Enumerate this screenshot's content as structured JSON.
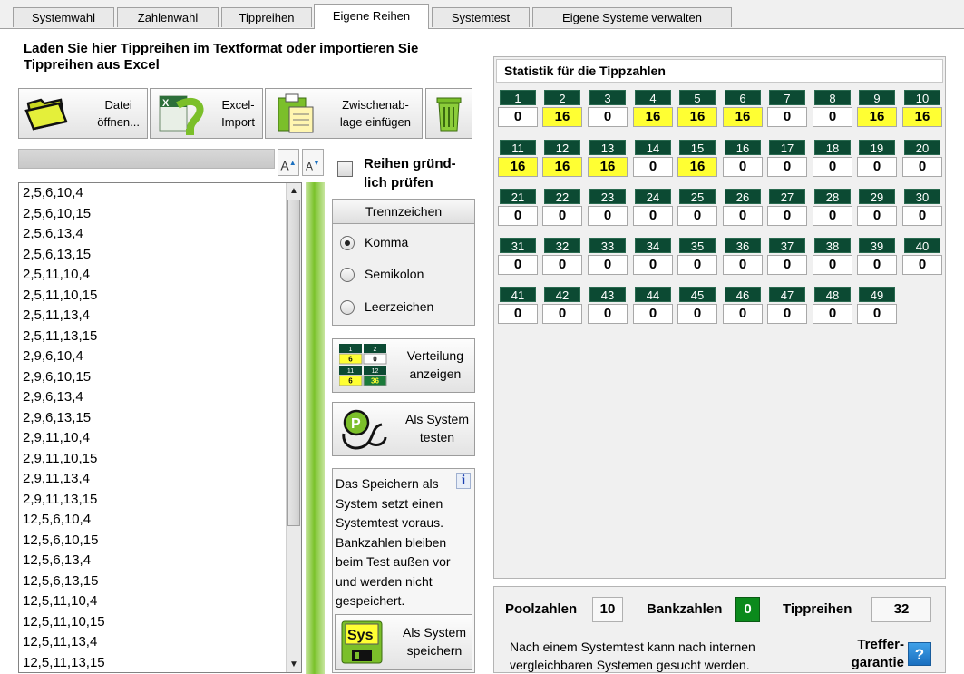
{
  "tabs": [
    {
      "label": "Systemwahl",
      "active": false
    },
    {
      "label": "Zahlenwahl",
      "active": false
    },
    {
      "label": "Tippreihen",
      "active": false
    },
    {
      "label": "Eigene Reihen",
      "active": true
    },
    {
      "label": "Systemtest",
      "active": false
    },
    {
      "label": "Eigene Systeme verwalten",
      "active": false
    }
  ],
  "intro": "Laden Sie hier Tippreihen im Textformat oder importieren Sie Tippreihen aus Excel",
  "toolbar": {
    "open_line1": "Datei",
    "open_line2": "öffnen...",
    "excel_line1": "Excel-",
    "excel_line2": "Import",
    "paste_line1": "Zwischenab-",
    "paste_line2": "lage einfügen",
    "icons": {
      "open": "folder-icon",
      "excel": "excel-icon",
      "paste": "clipboard-icon",
      "delete": "trash-icon"
    }
  },
  "font": {
    "increase": "A",
    "decrease": "A"
  },
  "check": {
    "line1": "Reihen gründ-",
    "line2": "lich prüfen",
    "checked": false
  },
  "separator": {
    "title": "Trennzeichen",
    "options": [
      "Komma",
      "Semikolon",
      "Leerzeichen"
    ],
    "selected": "Komma"
  },
  "buttons": {
    "distribution_line1": "Verteilung",
    "distribution_line2": "anzeigen",
    "test_line1": "Als System",
    "test_line2": "testen",
    "save_line1": "Als System",
    "save_line2": "speichern",
    "mini_grid": [
      {
        "n": "1",
        "c": "6"
      },
      {
        "n": "2",
        "c": "0"
      },
      {
        "n": "11",
        "c": "6"
      },
      {
        "n": "12",
        "c": "36"
      }
    ],
    "sys_label": "Sys"
  },
  "info": {
    "lines": [
      "Das Speichern als",
      "System setzt einen",
      "Systemtest voraus.",
      "Bankzahlen bleiben",
      "beim Test außen vor",
      "und werden nicht",
      "gespeichert."
    ],
    "icon": "i"
  },
  "rows": [
    "2,5,6,10,4",
    "2,5,6,10,15",
    "2,5,6,13,4",
    "2,5,6,13,15",
    "2,5,11,10,4",
    "2,5,11,10,15",
    "2,5,11,13,4",
    "2,5,11,13,15",
    "2,9,6,10,4",
    "2,9,6,10,15",
    "2,9,6,13,4",
    "2,9,6,13,15",
    "2,9,11,10,4",
    "2,9,11,10,15",
    "2,9,11,13,4",
    "2,9,11,13,15",
    "12,5,6,10,4",
    "12,5,6,10,15",
    "12,5,6,13,4",
    "12,5,6,13,15",
    "12,5,11,10,4",
    "12,5,11,10,15",
    "12,5,11,13,4",
    "12,5,11,13,15"
  ],
  "stats": {
    "title": "Statistik für die Tippzahlen",
    "numbers": [
      "1",
      "2",
      "3",
      "4",
      "5",
      "6",
      "7",
      "8",
      "9",
      "10",
      "11",
      "12",
      "13",
      "14",
      "15",
      "16",
      "17",
      "18",
      "19",
      "20",
      "21",
      "22",
      "23",
      "24",
      "25",
      "26",
      "27",
      "28",
      "29",
      "30",
      "31",
      "32",
      "33",
      "34",
      "35",
      "36",
      "37",
      "38",
      "39",
      "40",
      "41",
      "42",
      "43",
      "44",
      "45",
      "46",
      "47",
      "48",
      "49"
    ],
    "counts": [
      "0",
      "16",
      "0",
      "16",
      "16",
      "16",
      "0",
      "0",
      "16",
      "16",
      "16",
      "16",
      "16",
      "0",
      "16",
      "0",
      "0",
      "0",
      "0",
      "0",
      "0",
      "0",
      "0",
      "0",
      "0",
      "0",
      "0",
      "0",
      "0",
      "0",
      "0",
      "0",
      "0",
      "0",
      "0",
      "0",
      "0",
      "0",
      "0",
      "0",
      "0",
      "0",
      "0",
      "0",
      "0",
      "0",
      "0",
      "0",
      "0"
    ],
    "highlight_color": "#ffff33",
    "number_bg": "#0c4a33"
  },
  "summary": {
    "pool_label": "Poolzahlen",
    "pool_value": "10",
    "bank_label": "Bankzahlen",
    "bank_value": "0",
    "rows_label": "Tippreihen",
    "rows_value": "32",
    "note_line1": "Nach einem Systemtest kann nach internen",
    "note_line2": "vergleichbaren Systemen gesucht werden.",
    "treffer_line1": "Treffer-",
    "treffer_line2": "garantie",
    "help": "?"
  }
}
